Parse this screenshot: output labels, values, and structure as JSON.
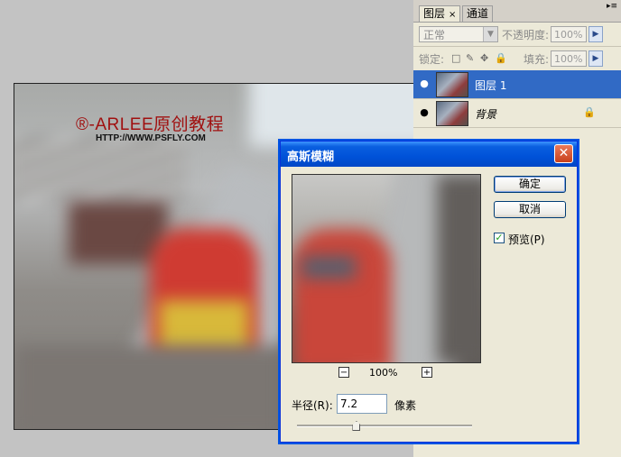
{
  "document": {
    "watermark_title": "®-ARLEE原创教程",
    "watermark_url": "HTTP://WWW.PSFLY.COM"
  },
  "layers_panel": {
    "tabs": [
      {
        "label": "图层",
        "active": true,
        "close": "×"
      },
      {
        "label": "通道",
        "active": false
      }
    ],
    "menu_glyph": "▸≡",
    "blend_mode": "正常",
    "opacity_label": "不透明度:",
    "opacity_value": "100%",
    "lock_label": "锁定:",
    "lock_icons": [
      "□",
      "✎",
      "✥",
      "🔒"
    ],
    "fill_label": "填充:",
    "fill_value": "100%",
    "arrow": "▶",
    "layers": [
      {
        "name": "图层 1",
        "visible": true,
        "selected": true
      },
      {
        "name": "背景",
        "visible": true,
        "selected": false,
        "locked": true
      }
    ],
    "eye_glyph": "●",
    "lock_glyph": "🔒"
  },
  "dialog": {
    "title": "高斯模糊",
    "close_glyph": "✕",
    "ok_label": "确定",
    "cancel_label": "取消",
    "preview_checked": true,
    "preview_check_glyph": "✓",
    "preview_label": "预览(P)",
    "zoom_minus": "−",
    "zoom_plus": "+",
    "zoom_level": "100%",
    "radius_label": "半径(R):",
    "radius_value": "7.2",
    "radius_unit": "像素",
    "slider_position": 0.34
  },
  "colors": {
    "selection": "#316ac5",
    "titlebar": "#0052d8",
    "panel_bg": "#ece9d8",
    "workspace_bg": "#c3c3c3"
  }
}
